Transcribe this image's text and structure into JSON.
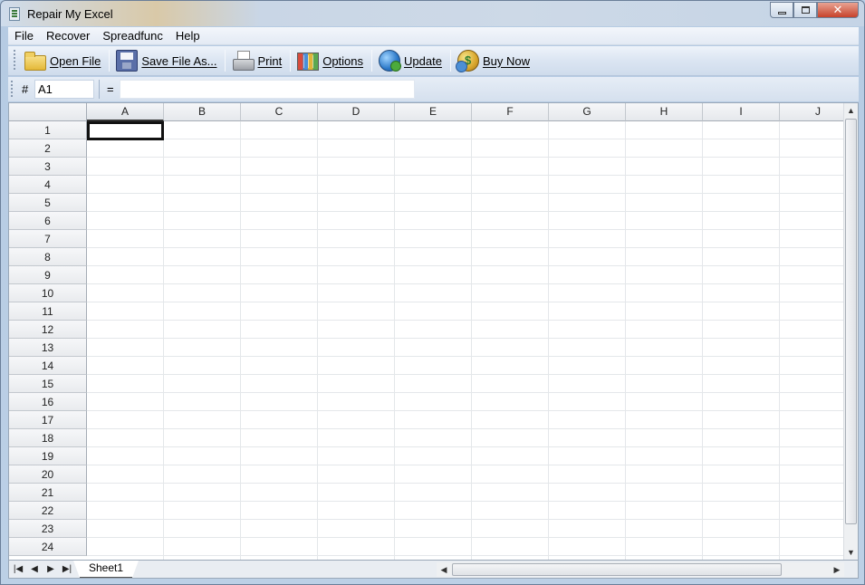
{
  "window": {
    "title": "Repair My Excel"
  },
  "menu": {
    "items": [
      {
        "label": "File"
      },
      {
        "label": "Recover"
      },
      {
        "label": "Spreadfunc"
      },
      {
        "label": "Help"
      }
    ]
  },
  "toolbar": {
    "open_label": "Open File",
    "save_label": "Save File As...",
    "print_label": "Print",
    "options_label": "Options",
    "update_label": "Update",
    "buynow_label": "Buy Now",
    "icons": {
      "open": "folder-icon",
      "save": "floppy-disk-icon",
      "print": "printer-icon",
      "options": "options-icon",
      "update": "globe-update-icon",
      "buynow": "coins-icon"
    }
  },
  "formula_bar": {
    "hash": "#",
    "cell_ref": "A1",
    "equals": "=",
    "formula": ""
  },
  "grid": {
    "columns": [
      "A",
      "B",
      "C",
      "D",
      "E",
      "F",
      "G",
      "H",
      "I",
      "J"
    ],
    "rows": [
      "1",
      "2",
      "3",
      "4",
      "5",
      "6",
      "7",
      "8",
      "9",
      "10",
      "11",
      "12",
      "13",
      "14",
      "15",
      "16",
      "17",
      "18",
      "19",
      "20",
      "21",
      "22",
      "23",
      "24"
    ],
    "selected_cell": "A1"
  },
  "sheets": {
    "tabs": [
      {
        "label": "Sheet1",
        "active": true
      }
    ]
  },
  "colors": {
    "accent": "#1f4f8f",
    "selection_border": "#111111",
    "gridline": "#e4e7ea"
  }
}
